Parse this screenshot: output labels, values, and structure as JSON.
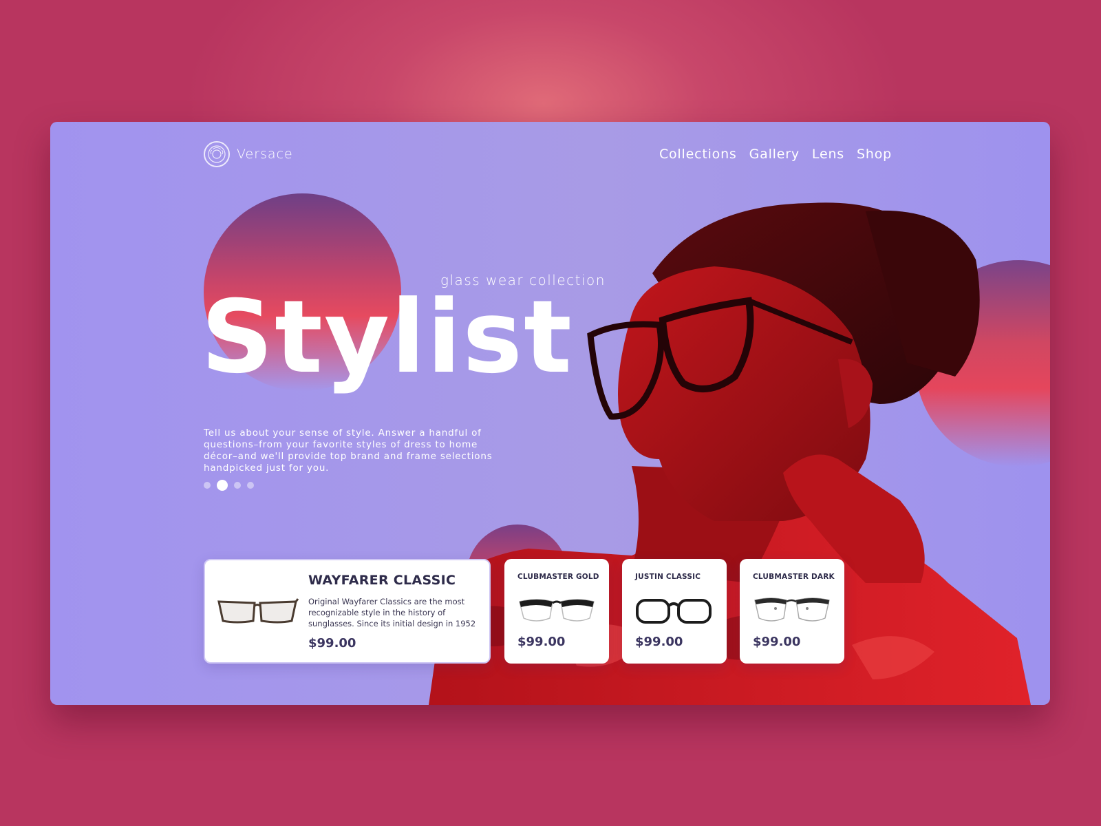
{
  "brand": {
    "name": "Versace",
    "logo_icon": "medusa-logo-icon"
  },
  "nav": {
    "items": [
      "Collections",
      "Gallery",
      "Lens",
      "Shop"
    ]
  },
  "hero": {
    "subtitle": "glass wear collection",
    "headline": "Stylist",
    "description": "Tell us about your sense of style. Answer a handful of questions–from your favorite styles of dress to home décor–and we'll provide top brand and frame selections handpicked just for you.",
    "slides": {
      "count": 4,
      "active_index": 1
    }
  },
  "products": [
    {
      "name": "WAYFARER CLASSIC",
      "description": "Original Wayfarer Classics are the most recognizable style in the history of sunglasses. Since its initial design in 1952",
      "price": "$99.00"
    },
    {
      "name": "CLUBMASTER GOLD",
      "price": "$99.00"
    },
    {
      "name": "JUSTIN CLASSIC",
      "price": "$99.00"
    },
    {
      "name": "CLUBMASTER DARK",
      "price": "$99.00"
    }
  ],
  "colors": {
    "page_background": "#b8355f",
    "panel_background": "#a193ef",
    "accent_red": "#e64a5f",
    "text_dark": "#2e2b4a"
  }
}
